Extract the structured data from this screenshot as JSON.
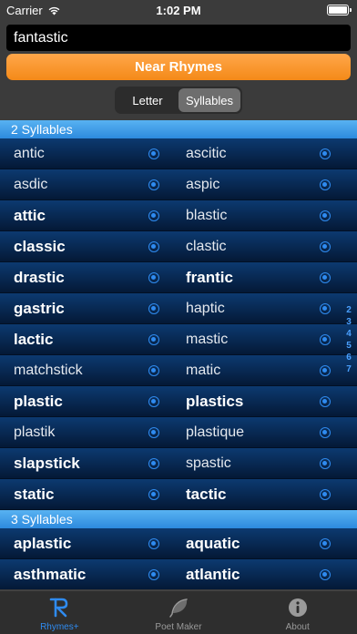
{
  "status_bar": {
    "carrier": "Carrier",
    "time": "1:02 PM"
  },
  "search": {
    "value": "fantastic"
  },
  "near_rhymes_button": {
    "label": "Near Rhymes"
  },
  "segments": [
    {
      "label": "Letter",
      "selected": false
    },
    {
      "label": "Syllables",
      "selected": true
    }
  ],
  "sections": [
    {
      "header": "2 Syllables",
      "rows": [
        [
          {
            "word": "antic",
            "bold": false
          },
          {
            "word": "ascitic",
            "bold": false
          }
        ],
        [
          {
            "word": "asdic",
            "bold": false
          },
          {
            "word": "aspic",
            "bold": false
          }
        ],
        [
          {
            "word": "attic",
            "bold": true
          },
          {
            "word": "blastic",
            "bold": false
          }
        ],
        [
          {
            "word": "classic",
            "bold": true
          },
          {
            "word": "clastic",
            "bold": false
          }
        ],
        [
          {
            "word": "drastic",
            "bold": true
          },
          {
            "word": "frantic",
            "bold": true
          }
        ],
        [
          {
            "word": "gastric",
            "bold": true
          },
          {
            "word": "haptic",
            "bold": false
          }
        ],
        [
          {
            "word": "lactic",
            "bold": true
          },
          {
            "word": "mastic",
            "bold": false
          }
        ],
        [
          {
            "word": "matchstick",
            "bold": false
          },
          {
            "word": "matic",
            "bold": false
          }
        ],
        [
          {
            "word": "plastic",
            "bold": true
          },
          {
            "word": "plastics",
            "bold": true
          }
        ],
        [
          {
            "word": "plastik",
            "bold": false
          },
          {
            "word": "plastique",
            "bold": false
          }
        ],
        [
          {
            "word": "slapstick",
            "bold": true
          },
          {
            "word": "spastic",
            "bold": false
          }
        ],
        [
          {
            "word": "static",
            "bold": true
          },
          {
            "word": "tactic",
            "bold": true
          }
        ]
      ]
    },
    {
      "header": "3 Syllables",
      "rows": [
        [
          {
            "word": "aplastic",
            "bold": true
          },
          {
            "word": "aquatic",
            "bold": true
          }
        ],
        [
          {
            "word": "asthmatic",
            "bold": true
          },
          {
            "word": "atlantic",
            "bold": true
          }
        ]
      ]
    }
  ],
  "section_index": [
    "2",
    "3",
    "4",
    "5",
    "6",
    "7"
  ],
  "tabs": [
    {
      "label": "Rhymes+",
      "icon": "rhymes-plus-icon",
      "active": true
    },
    {
      "label": "Poet Maker",
      "icon": "feather-icon",
      "active": false
    },
    {
      "label": "About",
      "icon": "info-icon",
      "active": false
    }
  ],
  "colors": {
    "accent": "#2f8bf0",
    "button_orange": "#f7941d",
    "section_header": "#3d9ae8",
    "row_background": "#062650"
  }
}
